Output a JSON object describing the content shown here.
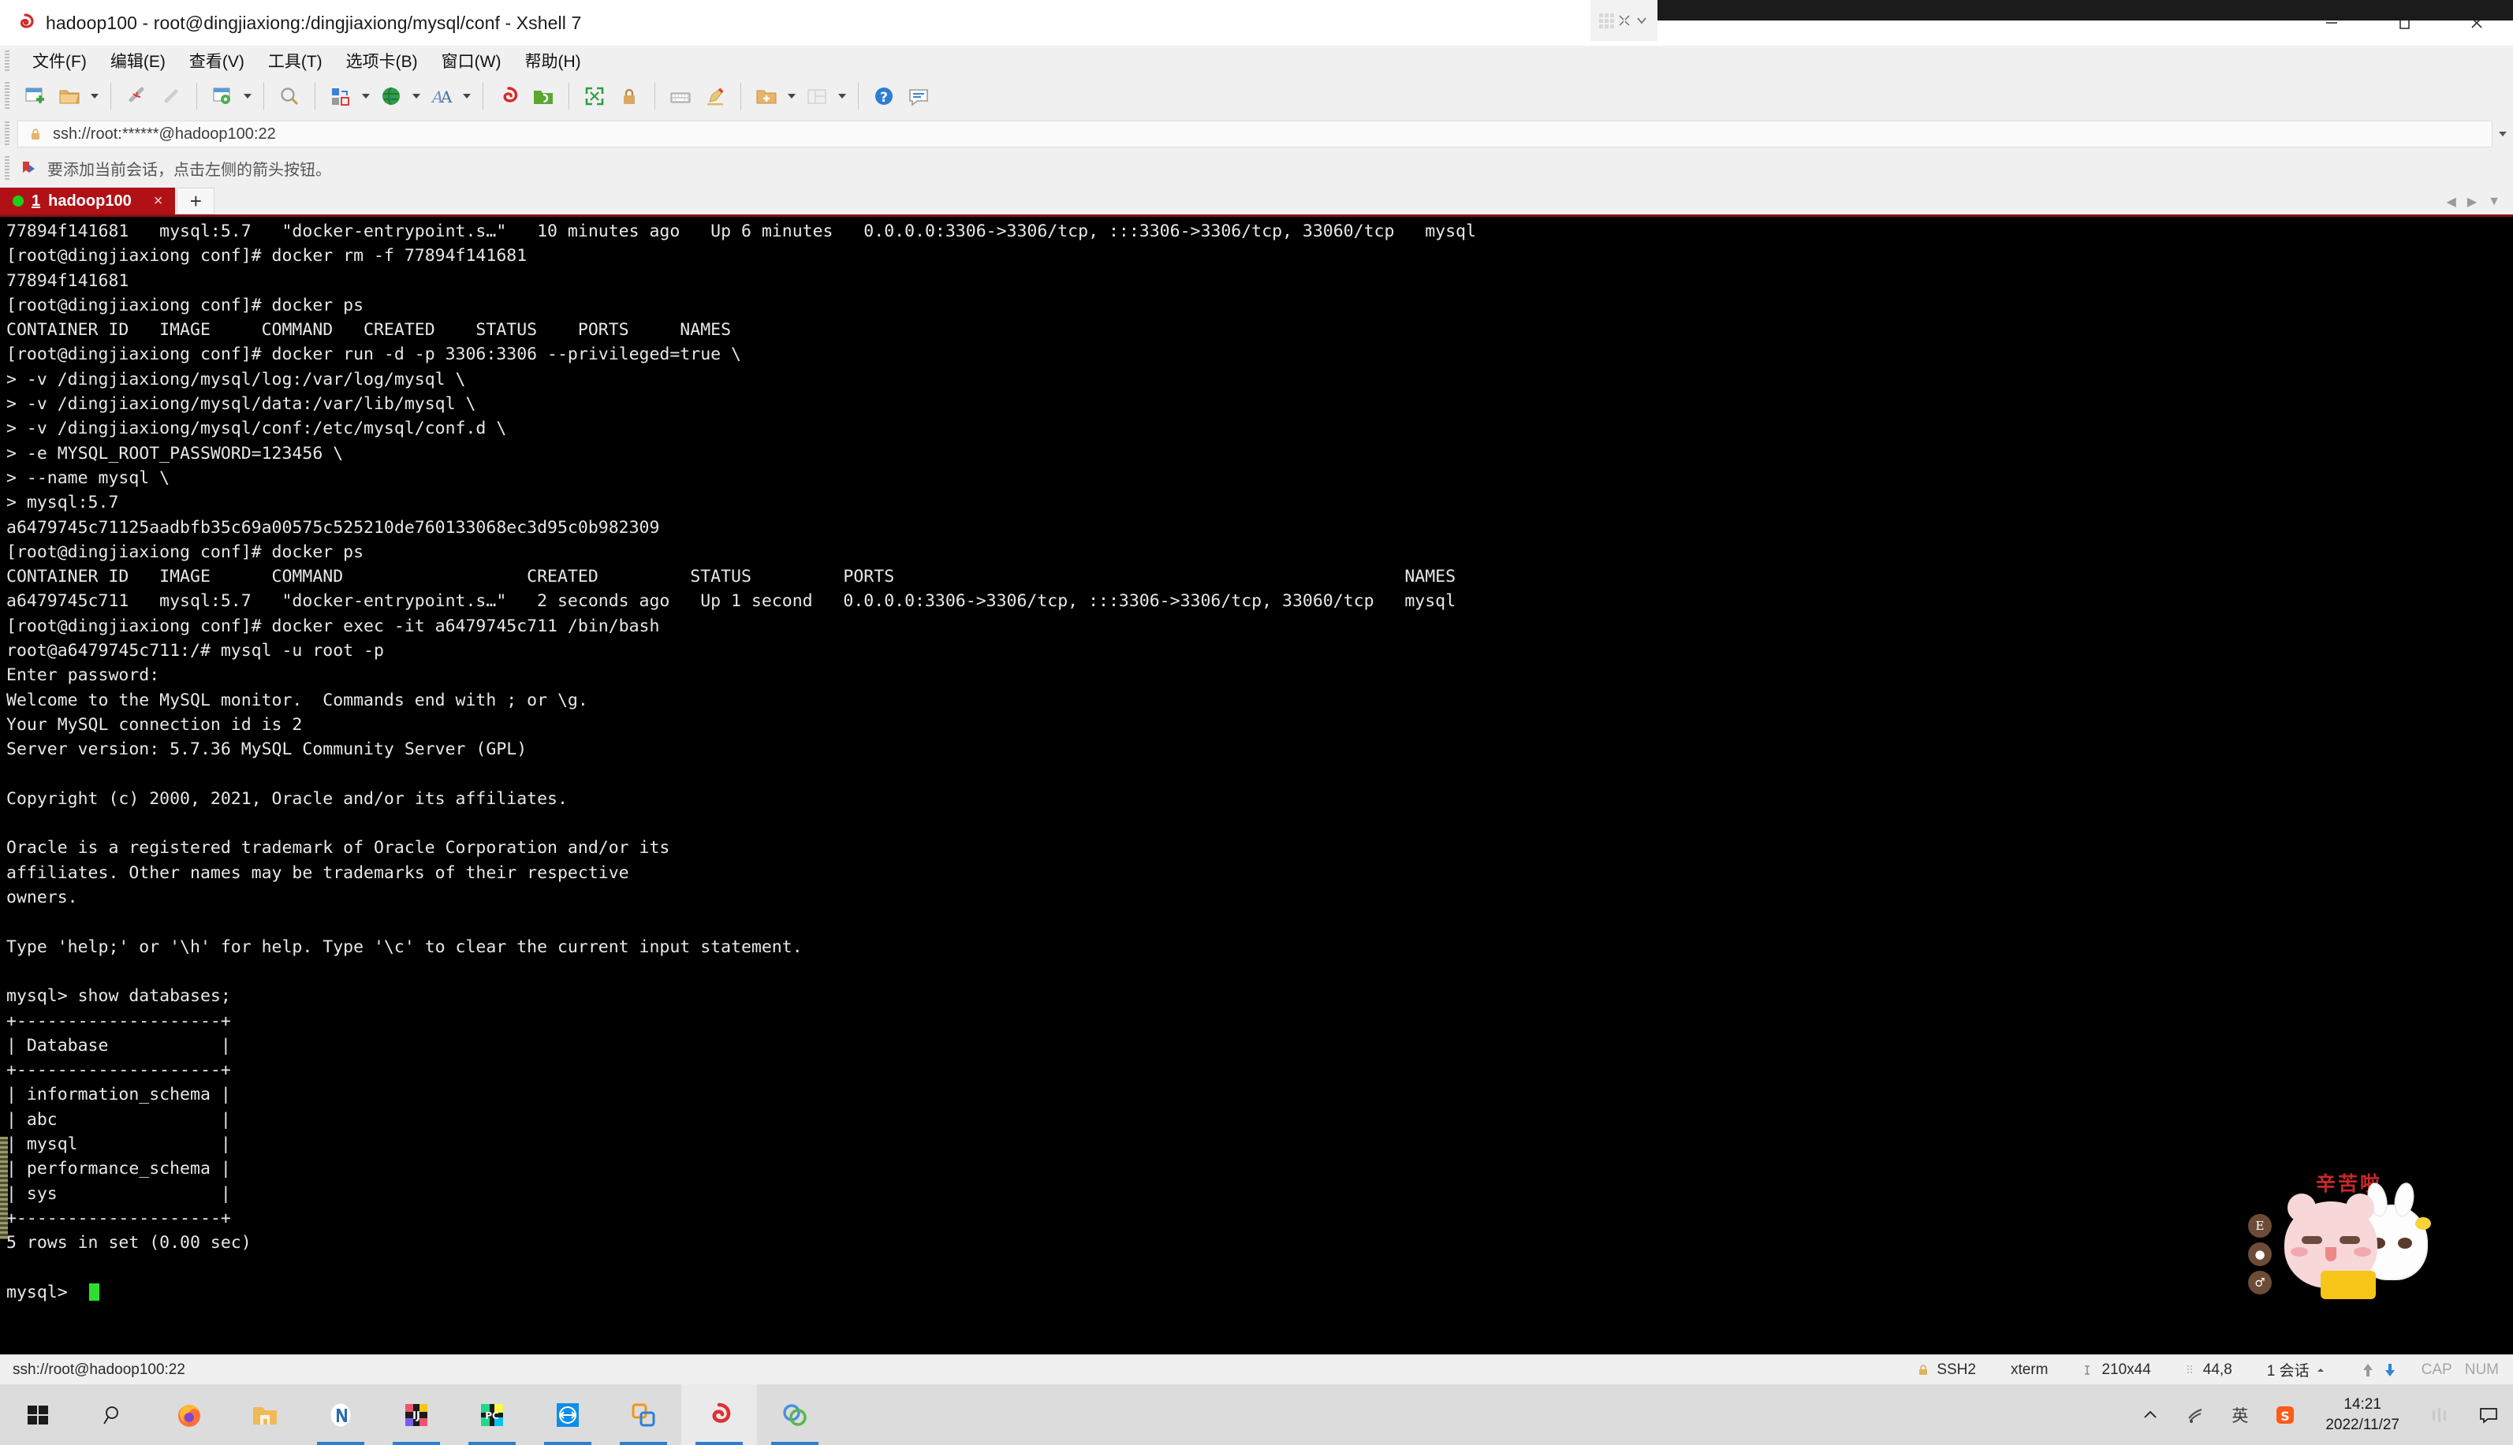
{
  "window": {
    "title": "hadoop100 - root@dingjiaxiong:/dingjiaxiong/mysql/conf - Xshell 7",
    "app_icon": "xshell-icon",
    "minimize_label": "–",
    "maximize_label": "❐",
    "close_label": "✕"
  },
  "menu": {
    "items": [
      {
        "label": "文件(F)",
        "name": "menu-file"
      },
      {
        "label": "编辑(E)",
        "name": "menu-edit"
      },
      {
        "label": "查看(V)",
        "name": "menu-view"
      },
      {
        "label": "工具(T)",
        "name": "menu-tools"
      },
      {
        "label": "选项卡(B)",
        "name": "menu-tabs"
      },
      {
        "label": "窗口(W)",
        "name": "menu-window"
      },
      {
        "label": "帮助(H)",
        "name": "menu-help"
      }
    ]
  },
  "toolbar": {
    "icons": [
      "new-session-icon",
      "open-folder-icon",
      "disconnect-icon",
      "reconnect-icon",
      "session-properties-icon",
      "find-icon",
      "transfer-icon",
      "globe-icon",
      "font-icon",
      "xshell-icon",
      "xftp-icon",
      "fullscreen-icon",
      "lock-icon",
      "keyboard-icon",
      "highlight-icon",
      "add-folder-icon",
      "layout-icon",
      "help-icon",
      "feedback-icon"
    ]
  },
  "address_bar": {
    "value": "ssh://root:******@hadoop100:22",
    "lock_icon": "lock-icon",
    "dropdown_icon": "chevron-down-icon"
  },
  "hint_bar": {
    "icon": "bookmark-arrow-icon",
    "text": "要添加当前会话，点击左侧的箭头按钮。"
  },
  "tabs": {
    "active": {
      "number": "1",
      "title": "hadoop100",
      "close_label": "×",
      "status_dot": "#19d119"
    },
    "add_label": "+",
    "scroll_left": "◀",
    "scroll_right": "▶",
    "scroll_menu": "▼"
  },
  "terminal": {
    "background": "#000000",
    "foreground": "#e8e8e8",
    "cursor_color": "#2ee02e",
    "lines": [
      "77894f141681   mysql:5.7   \"docker-entrypoint.s…\"   10 minutes ago   Up 6 minutes   0.0.0.0:3306->3306/tcp, :::3306->3306/tcp, 33060/tcp   mysql",
      "[root@dingjiaxiong conf]# docker rm -f 77894f141681",
      "77894f141681",
      "[root@dingjiaxiong conf]# docker ps",
      "CONTAINER ID   IMAGE     COMMAND   CREATED    STATUS    PORTS     NAMES",
      "[root@dingjiaxiong conf]# docker run -d -p 3306:3306 --privileged=true \\",
      "> -v /dingjiaxiong/mysql/log:/var/log/mysql \\",
      "> -v /dingjiaxiong/mysql/data:/var/lib/mysql \\",
      "> -v /dingjiaxiong/mysql/conf:/etc/mysql/conf.d \\",
      "> -e MYSQL_ROOT_PASSWORD=123456 \\",
      "> --name mysql \\",
      "> mysql:5.7",
      "a6479745c71125aadbfb35c69a00575c525210de760133068ec3d95c0b982309",
      "[root@dingjiaxiong conf]# docker ps",
      "CONTAINER ID   IMAGE      COMMAND                  CREATED         STATUS         PORTS                                                  NAMES",
      "a6479745c711   mysql:5.7   \"docker-entrypoint.s…\"   2 seconds ago   Up 1 second   0.0.0.0:3306->3306/tcp, :::3306->3306/tcp, 33060/tcp   mysql",
      "[root@dingjiaxiong conf]# docker exec -it a6479745c711 /bin/bash",
      "root@a6479745c711:/# mysql -u root -p",
      "Enter password:",
      "Welcome to the MySQL monitor.  Commands end with ; or \\g.",
      "Your MySQL connection id is 2",
      "Server version: 5.7.36 MySQL Community Server (GPL)",
      "",
      "Copyright (c) 2000, 2021, Oracle and/or its affiliates.",
      "",
      "Oracle is a registered trademark of Oracle Corporation and/or its",
      "affiliates. Other names may be trademarks of their respective",
      "owners.",
      "",
      "Type 'help;' or '\\h' for help. Type '\\c' to clear the current input statement.",
      "",
      "mysql> show databases;",
      "+--------------------+",
      "| Database           |",
      "+--------------------+",
      "| information_schema |",
      "| abc                |",
      "| mysql              |",
      "| performance_schema |",
      "| sys                |",
      "+--------------------+",
      "5 rows in set (0.00 sec)",
      ""
    ],
    "prompt": "mysql> "
  },
  "sticker": {
    "text": "辛苦啦",
    "badges": [
      "E",
      "●",
      "♂"
    ]
  },
  "statusbar": {
    "connection": "ssh://root@hadoop100:22",
    "protocol": "SSH2",
    "terminal_type": "xterm",
    "size": "210x44",
    "cursor_pos": "44,8",
    "sessions": "1 会话",
    "cap": "CAP",
    "num": "NUM"
  },
  "taskbar": {
    "items": [
      {
        "name": "start-button",
        "icon": "windows-logo-icon"
      },
      {
        "name": "search-button",
        "icon": "search-icon"
      },
      {
        "name": "taskbar-firefox",
        "icon": "firefox-icon"
      },
      {
        "name": "taskbar-file-explorer",
        "icon": "folder-icon"
      },
      {
        "name": "taskbar-navicat",
        "icon": "navicat-icon"
      },
      {
        "name": "taskbar-intellij-idea",
        "icon": "intellij-idea-icon"
      },
      {
        "name": "taskbar-pycharm",
        "icon": "pycharm-icon"
      },
      {
        "name": "taskbar-teamviewer",
        "icon": "teamviewer-icon"
      },
      {
        "name": "taskbar-vmware",
        "icon": "vmware-icon"
      },
      {
        "name": "taskbar-xshell",
        "icon": "xshell-icon"
      },
      {
        "name": "taskbar-xftp",
        "icon": "xftp-icon"
      }
    ],
    "tray": {
      "chevron": "chevron-up-icon",
      "network": "wifi-icon",
      "ime": "英",
      "sogou": "sogou-icon",
      "time": "14:21",
      "date": "2022/11/27",
      "volume": "volume-icon",
      "action_center": "notification-icon"
    }
  }
}
